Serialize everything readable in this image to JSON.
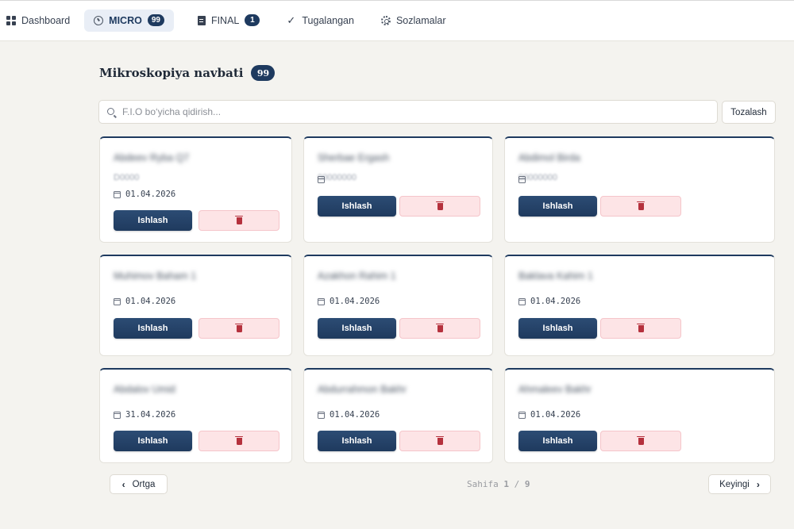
{
  "nav": {
    "dashboard": "Dashboard",
    "micro": "MICRO",
    "micro_count": "99",
    "final": "FINAL",
    "final_count": "1",
    "done": "Tugalangan",
    "settings": "Sozlamalar"
  },
  "header": {
    "title": "Mikroskopiya navbati",
    "count": "99"
  },
  "search": {
    "placeholder": "F.I.O bo‘yicha qidirish...",
    "value": "",
    "clear_label": "Tozalash"
  },
  "cards": [
    {
      "name": "Abdeev Ryba Q7",
      "sub": "D0000",
      "date": "01.04.2026"
    },
    {
      "name": "Sherbae Ergash",
      "sub": "00000000",
      "date": ""
    },
    {
      "name": "Abdimol Birda",
      "sub": "00000000",
      "date": ""
    },
    {
      "name": "Muhimov Baham 1",
      "sub": "",
      "date": "01.04.2026"
    },
    {
      "name": "Azakhon Rahim 1",
      "sub": "",
      "date": "01.04.2026"
    },
    {
      "name": "Baklava Kahim 1",
      "sub": "",
      "date": "01.04.2026"
    },
    {
      "name": "Abdalov Umid",
      "sub": "",
      "date": "31.04.2026"
    },
    {
      "name": "Abdurrahmon Bakhr",
      "sub": "",
      "date": "01.04.2026"
    },
    {
      "name": "Ahmaleev Bakhr",
      "sub": "",
      "date": "01.04.2026"
    }
  ],
  "card_actions": {
    "process_label": "Ishlash"
  },
  "pagination": {
    "prev_label": "Ortga",
    "next_label": "Keyingi",
    "page_word": "Sahifa",
    "current": "1",
    "separator": "/",
    "total": "9"
  },
  "colors": {
    "primary": "#1e3a5f",
    "danger_bg": "#fde4e6",
    "danger_icon": "#b5313d",
    "background": "#f4f3ef"
  }
}
